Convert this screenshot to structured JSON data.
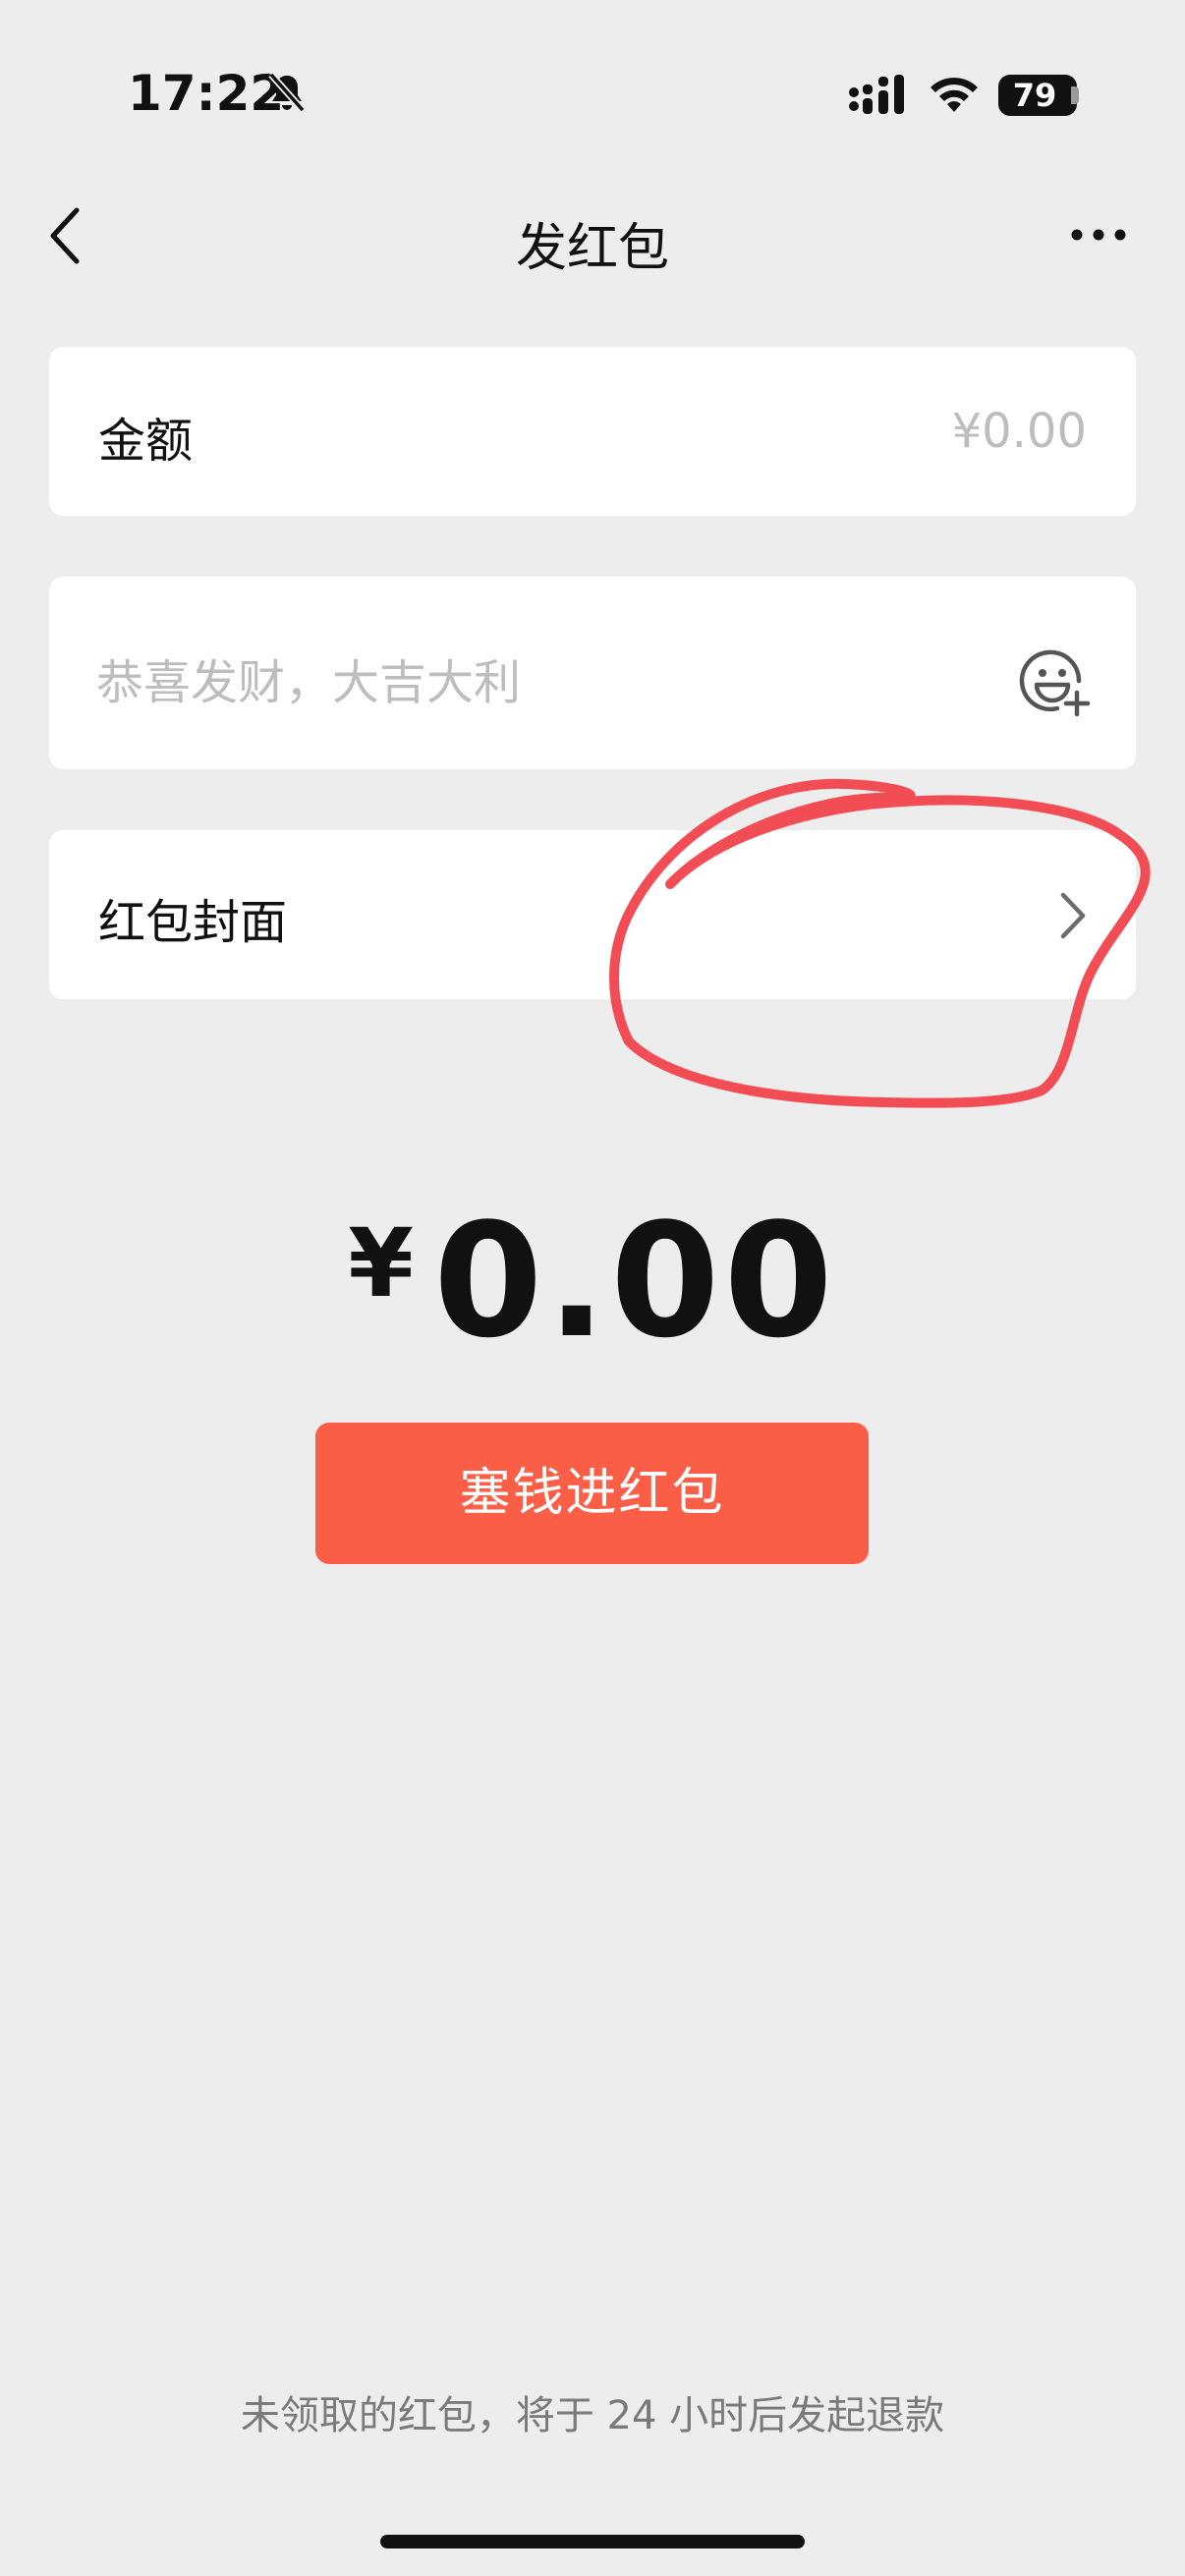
{
  "status_bar": {
    "time": "17:22",
    "battery": "79"
  },
  "nav": {
    "title": "发红包"
  },
  "amount_card": {
    "label": "金额",
    "placeholder": "¥0.00"
  },
  "greeting_card": {
    "placeholder": "恭喜发财，大吉大利"
  },
  "cover_card": {
    "label": "红包封面"
  },
  "total": {
    "currency": "¥",
    "value": "0.00"
  },
  "actions": {
    "stuff_label": "塞钱进红包"
  },
  "footer": {
    "note": "未领取的红包，将于 24 小时后发起退款"
  },
  "colors": {
    "accent": "#fa5e47",
    "annotation": "#f24d55"
  },
  "icons": [
    "bell-muted-icon",
    "signal-icon",
    "wifi-icon",
    "battery-icon",
    "back-icon",
    "more-icon",
    "emoji-add-icon",
    "chevron-right-icon"
  ]
}
